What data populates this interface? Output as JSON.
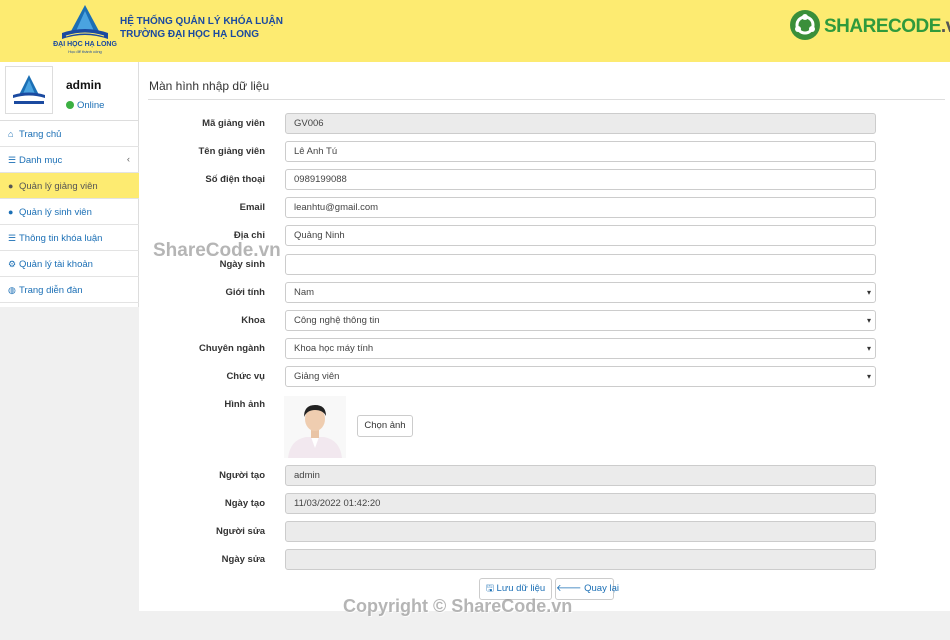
{
  "header": {
    "logo_text": "ĐẠI HỌC HẠ LONG",
    "logo_subtext": "Học để thành công",
    "title_line1": "HỆ THỐNG QUẢN LÝ KHÓA LUẬN",
    "title_line2": "TRƯỜNG ĐẠI HỌC HẠ LONG",
    "brand_part1": "SHARECODE",
    "brand_part2": ".vn"
  },
  "sidebar": {
    "user_name": "admin",
    "user_status": "Online",
    "items": [
      {
        "label": "Trang chủ",
        "icon": "home-icon"
      },
      {
        "label": "Danh mục",
        "icon": "list-icon"
      },
      {
        "label": "Quản lý giảng viên",
        "icon": "user-icon",
        "active": true
      },
      {
        "label": "Quản lý sinh viên",
        "icon": "users-icon"
      },
      {
        "label": "Thông tin khóa luận",
        "icon": "list-icon"
      },
      {
        "label": "Quản lý tài khoản",
        "icon": "gears-icon"
      },
      {
        "label": "Trang diễn đàn",
        "icon": "globe-icon"
      }
    ]
  },
  "form": {
    "title": "Màn hình nhập dữ liệu",
    "fields": {
      "ma_gv": {
        "label": "Mã giảng viên",
        "value": "GV006"
      },
      "ten_gv": {
        "label": "Tên giảng viên",
        "value": "Lê Anh Tú"
      },
      "sdt": {
        "label": "Số điện thoại",
        "value": "0989199088"
      },
      "email": {
        "label": "Email",
        "value": "leanhtu@gmail.com"
      },
      "dia_chi": {
        "label": "Địa chỉ",
        "value": "Quảng Ninh"
      },
      "ngay_sinh": {
        "label": "Ngày sinh",
        "value": ""
      },
      "gioi_tinh": {
        "label": "Giới tính",
        "value": "Nam"
      },
      "khoa": {
        "label": "Khoa",
        "value": "Công nghệ thông tin"
      },
      "chuyen_nganh": {
        "label": "Chuyên ngành",
        "value": "Khoa học máy tính"
      },
      "chuc_vu": {
        "label": "Chức vụ",
        "value": "Giảng viên"
      },
      "hinh_anh": {
        "label": "Hình ảnh",
        "button": "Chọn ảnh"
      },
      "nguoi_tao": {
        "label": "Người tạo",
        "value": "admin"
      },
      "ngay_tao": {
        "label": "Ngày tạo",
        "value": "11/03/2022 01:42:20"
      },
      "nguoi_sua": {
        "label": "Người sửa",
        "value": ""
      },
      "ngay_sua": {
        "label": "Ngày sửa",
        "value": ""
      }
    },
    "save_label": "Lưu dữ liệu",
    "back_label": "Quay lại"
  },
  "watermarks": {
    "mid": "ShareCode.vn",
    "bottom": "Copyright © ShareCode.vn"
  }
}
